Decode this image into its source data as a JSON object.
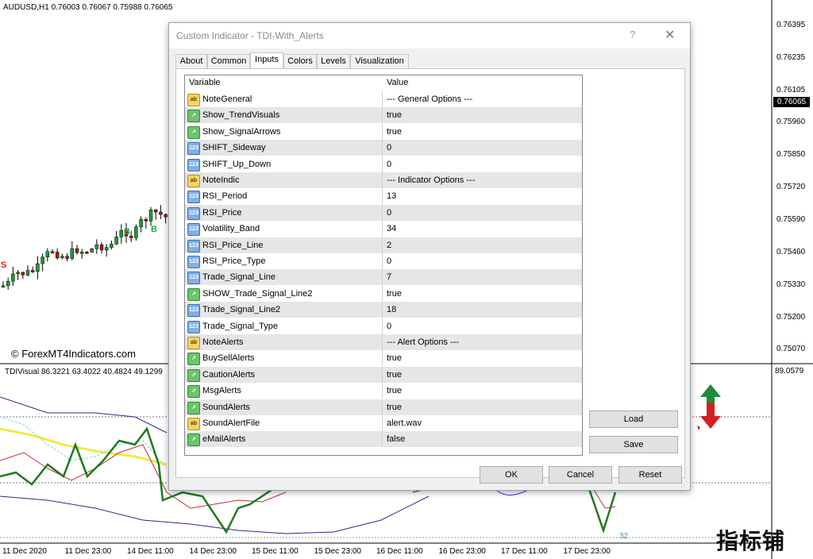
{
  "chart": {
    "symbol_line": "AUDUSD,H1  0.76003 0.76067 0.75988 0.76065",
    "watermark": "© ForexMT4Indicators.com",
    "current_price": "0.76065",
    "price_labels": [
      "0.76395",
      "0.76235",
      "0.76105",
      "0.75960",
      "0.75850",
      "0.75720",
      "0.75590",
      "0.75460",
      "0.75330",
      "0.75200",
      "0.75070"
    ],
    "indicator_line": "TDIVisual 86.3221 63.4022 40.4824 49.1299",
    "indicator_level": "89.0579",
    "indicator_low": "32",
    "date_labels": [
      "11 Dec 2020",
      "11 Dec 23:00",
      "14 Dec 11:00",
      "14 Dec 23:00",
      "15 Dec 11:00",
      "15 Dec 23:00",
      "16 Dec 11:00",
      "16 Dec 23:00",
      "17 Dec 11:00",
      "17 Dec 23:00"
    ],
    "signal_letters": [
      "S",
      "B",
      "B"
    ],
    "site_logo": "指标铺"
  },
  "dialog": {
    "title": "Custom Indicator - TDI-With_Alerts",
    "help_label": "?",
    "close_label": "✕",
    "tabs": [
      "About",
      "Common",
      "Inputs",
      "Colors",
      "Levels",
      "Visualization"
    ],
    "active_tab": "Inputs",
    "columns": {
      "variable": "Variable",
      "value": "Value"
    },
    "rows": [
      {
        "icon": "ab",
        "name": "NoteGeneral",
        "value": "--- General Options ---"
      },
      {
        "icon": "bool",
        "name": "Show_TrendVisuals",
        "value": "true"
      },
      {
        "icon": "bool",
        "name": "Show_SignalArrows",
        "value": "true"
      },
      {
        "icon": "num",
        "name": "SHIFT_Sideway",
        "value": "0"
      },
      {
        "icon": "num",
        "name": "SHIFT_Up_Down",
        "value": "0"
      },
      {
        "icon": "ab",
        "name": "NoteIndic",
        "value": "--- Indicator Options ---"
      },
      {
        "icon": "num",
        "name": "RSI_Period",
        "value": "13"
      },
      {
        "icon": "num",
        "name": "RSI_Price",
        "value": "0"
      },
      {
        "icon": "num",
        "name": "Volatility_Band",
        "value": "34"
      },
      {
        "icon": "num",
        "name": "RSI_Price_Line",
        "value": "2"
      },
      {
        "icon": "num",
        "name": "RSI_Price_Type",
        "value": "0"
      },
      {
        "icon": "num",
        "name": "Trade_Signal_Line",
        "value": "7"
      },
      {
        "icon": "bool",
        "name": "SHOW_Trade_Signal_Line2",
        "value": "true"
      },
      {
        "icon": "num",
        "name": "Trade_Signal_Line2",
        "value": "18"
      },
      {
        "icon": "num",
        "name": "Trade_Signal_Type",
        "value": "0"
      },
      {
        "icon": "ab",
        "name": "NoteAlerts",
        "value": "--- Alert Options ---"
      },
      {
        "icon": "bool",
        "name": "BuySellAlerts",
        "value": "true"
      },
      {
        "icon": "bool",
        "name": "CautionAlerts",
        "value": "true"
      },
      {
        "icon": "bool",
        "name": "MsgAlerts",
        "value": "true"
      },
      {
        "icon": "bool",
        "name": "SoundAlerts",
        "value": "true"
      },
      {
        "icon": "ab",
        "name": "SoundAlertFile",
        "value": "alert.wav"
      },
      {
        "icon": "bool",
        "name": "eMailAlerts",
        "value": "false"
      }
    ],
    "icon_glyphs": {
      "ab": "ab",
      "bool": "↗",
      "num": "123"
    },
    "load_label": "Load",
    "save_label": "Save",
    "ok_label": "OK",
    "cancel_label": "Cancel",
    "reset_label": "Reset"
  }
}
